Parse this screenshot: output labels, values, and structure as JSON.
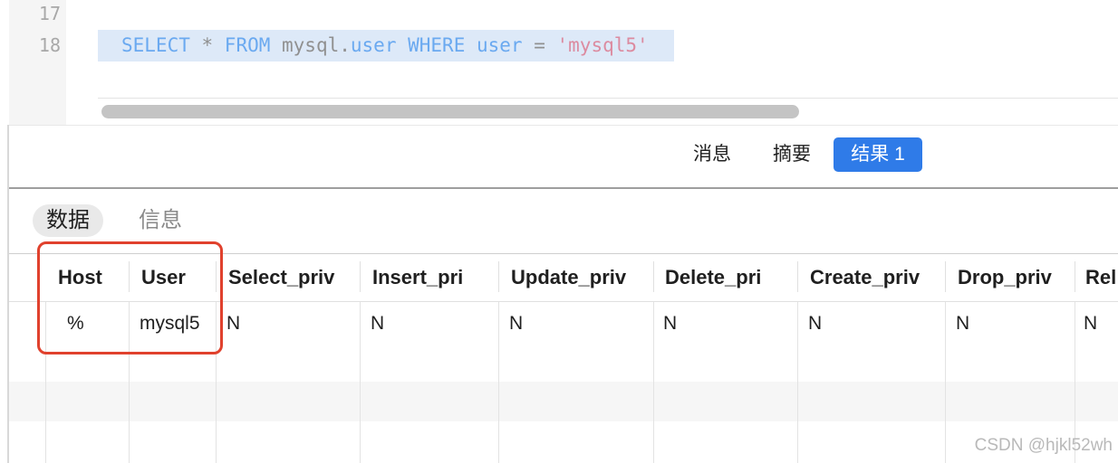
{
  "editor": {
    "line_numbers": [
      "17",
      "18"
    ],
    "query_tokens": [
      {
        "text": "SELECT",
        "kind": "keyword"
      },
      {
        "text": " * ",
        "kind": "plain"
      },
      {
        "text": "FROM",
        "kind": "keyword"
      },
      {
        "text": " mysql.",
        "kind": "plain"
      },
      {
        "text": "user",
        "kind": "keyword"
      },
      {
        "text": " ",
        "kind": "plain"
      },
      {
        "text": "WHERE",
        "kind": "keyword"
      },
      {
        "text": " ",
        "kind": "plain"
      },
      {
        "text": "user",
        "kind": "keyword"
      },
      {
        "text": " = ",
        "kind": "plain"
      },
      {
        "text": "'mysql5'",
        "kind": "string"
      }
    ]
  },
  "result_tabs": [
    "消息",
    "摘要",
    "结果 1"
  ],
  "active_result_tab": "结果 1",
  "sub_tabs": [
    "数据",
    "信息"
  ],
  "active_sub_tab": "数据",
  "grid": {
    "columns": [
      "Host",
      "User",
      "Select_priv",
      "Insert_pri",
      "Update_priv",
      "Delete_pri",
      "Create_priv",
      "Drop_priv",
      "Rel"
    ],
    "rows": [
      [
        "%",
        "mysql5",
        "N",
        "N",
        "N",
        "N",
        "N",
        "N",
        "N"
      ]
    ]
  },
  "watermark": "CSDN @hjkl52wh",
  "colors": {
    "keyword": "#6aa9f0",
    "string": "#dc8ba0",
    "selection": "#dde9f8",
    "active_tab": "#2f7be8",
    "highlight_box": "#e0412d"
  }
}
